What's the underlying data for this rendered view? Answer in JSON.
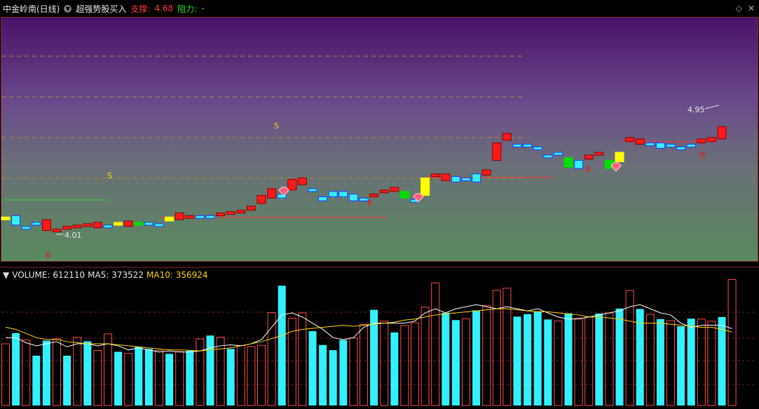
{
  "header": {
    "stock": "中金岭南(日线)",
    "indicator": "超强势股买入",
    "support_label": "支撑:",
    "support_value": "4.68",
    "resistance_label": "阻力:",
    "resistance_value": "-"
  },
  "volume_header": {
    "label": "VOLUME: 612110",
    "ma5": "MA5: 373522",
    "ma10": "MA10: 356924"
  },
  "colors": {
    "up": "#ff1a1a",
    "down": "#33f0ff",
    "flat": "#ffff00",
    "green": "#00e000"
  },
  "chart_data": {
    "type": "candlestick",
    "price_annotations": {
      "high": "4.95",
      "low": "4.01"
    },
    "markers": {
      "B": "B",
      "S": "S"
    },
    "candles": [
      {
        "o": 4.15,
        "c": 4.16,
        "h": 4.16,
        "l": 4.14,
        "t": "flat"
      },
      {
        "o": 4.17,
        "c": 4.1,
        "h": 4.17,
        "l": 4.1,
        "t": "down"
      },
      {
        "o": 4.09,
        "c": 4.08,
        "h": 4.09,
        "l": 4.07,
        "t": "down"
      },
      {
        "o": 4.11,
        "c": 4.12,
        "h": 4.13,
        "l": 4.1,
        "t": "down"
      },
      {
        "o": 4.06,
        "c": 4.14,
        "h": 4.14,
        "l": 4.05,
        "t": "up"
      },
      {
        "o": 4.06,
        "c": 4.07,
        "h": 4.08,
        "l": 4.05,
        "t": "up"
      },
      {
        "o": 4.07,
        "c": 4.09,
        "h": 4.1,
        "l": 4.06,
        "t": "up"
      },
      {
        "o": 4.08,
        "c": 4.1,
        "h": 4.1,
        "l": 4.08,
        "t": "up"
      },
      {
        "o": 4.1,
        "c": 4.11,
        "h": 4.11,
        "l": 4.09,
        "t": "up"
      },
      {
        "o": 4.08,
        "c": 4.12,
        "h": 4.12,
        "l": 4.07,
        "t": "up"
      },
      {
        "o": 4.1,
        "c": 4.08,
        "h": 4.1,
        "l": 4.08,
        "t": "down"
      },
      {
        "o": 4.1,
        "c": 4.12,
        "h": 4.12,
        "l": 4.1,
        "t": "flat"
      },
      {
        "o": 4.09,
        "c": 4.13,
        "h": 4.13,
        "l": 4.09,
        "t": "up"
      },
      {
        "o": 4.11,
        "c": 4.12,
        "h": 4.12,
        "l": 4.11,
        "t": "green"
      },
      {
        "o": 4.12,
        "c": 4.11,
        "h": 4.12,
        "l": 4.11,
        "t": "down"
      },
      {
        "o": 4.11,
        "c": 4.1,
        "h": 4.11,
        "l": 4.1,
        "t": "down"
      },
      {
        "o": 4.13,
        "c": 4.16,
        "h": 4.16,
        "l": 4.13,
        "t": "flat"
      },
      {
        "o": 4.14,
        "c": 4.19,
        "h": 4.19,
        "l": 4.14,
        "t": "up"
      },
      {
        "o": 4.16,
        "c": 4.17,
        "h": 4.17,
        "l": 4.15,
        "t": "up"
      },
      {
        "o": 4.17,
        "c": 4.16,
        "h": 4.17,
        "l": 4.16,
        "t": "down"
      },
      {
        "o": 4.17,
        "c": 4.16,
        "h": 4.17,
        "l": 4.16,
        "t": "down"
      },
      {
        "o": 4.18,
        "c": 4.19,
        "h": 4.19,
        "l": 4.17,
        "t": "up"
      },
      {
        "o": 4.18,
        "c": 4.2,
        "h": 4.2,
        "l": 4.18,
        "t": "up"
      },
      {
        "o": 4.19,
        "c": 4.21,
        "h": 4.21,
        "l": 4.19,
        "t": "up"
      },
      {
        "o": 4.21,
        "c": 4.24,
        "h": 4.24,
        "l": 4.21,
        "t": "up"
      },
      {
        "o": 4.26,
        "c": 4.32,
        "h": 4.33,
        "l": 4.26,
        "t": "up"
      },
      {
        "o": 4.3,
        "c": 4.37,
        "h": 4.38,
        "l": 4.3,
        "t": "up"
      },
      {
        "o": 4.33,
        "c": 4.3,
        "h": 4.33,
        "l": 4.29,
        "t": "down"
      },
      {
        "o": 4.36,
        "c": 4.44,
        "h": 4.44,
        "l": 4.36,
        "t": "up"
      },
      {
        "o": 4.4,
        "c": 4.45,
        "h": 4.46,
        "l": 4.39,
        "t": "up"
      },
      {
        "o": 4.37,
        "c": 4.36,
        "h": 4.37,
        "l": 4.36,
        "t": "down"
      },
      {
        "o": 4.31,
        "c": 4.28,
        "h": 4.31,
        "l": 4.28,
        "t": "down"
      },
      {
        "o": 4.35,
        "c": 4.31,
        "h": 4.35,
        "l": 4.3,
        "t": "down"
      },
      {
        "o": 4.35,
        "c": 4.31,
        "h": 4.35,
        "l": 4.3,
        "t": "down"
      },
      {
        "o": 4.33,
        "c": 4.28,
        "h": 4.33,
        "l": 4.28,
        "t": "down"
      },
      {
        "o": 4.3,
        "c": 4.3,
        "h": 4.3,
        "l": 4.3,
        "t": "down"
      },
      {
        "o": 4.31,
        "c": 4.33,
        "h": 4.33,
        "l": 4.31,
        "t": "up"
      },
      {
        "o": 4.35,
        "c": 4.36,
        "h": 4.36,
        "l": 4.34,
        "t": "up"
      },
      {
        "o": 4.35,
        "c": 4.38,
        "h": 4.38,
        "l": 4.34,
        "t": "up"
      },
      {
        "o": 4.35,
        "c": 4.3,
        "h": 4.35,
        "l": 4.29,
        "t": "green"
      },
      {
        "o": 4.29,
        "c": 4.28,
        "h": 4.29,
        "l": 4.28,
        "t": "down"
      },
      {
        "o": 4.32,
        "c": 4.45,
        "h": 4.45,
        "l": 4.32,
        "t": "flat"
      },
      {
        "o": 4.47,
        "c": 4.48,
        "h": 4.48,
        "l": 4.47,
        "t": "up"
      },
      {
        "o": 4.43,
        "c": 4.48,
        "h": 4.48,
        "l": 4.42,
        "t": "up"
      },
      {
        "o": 4.46,
        "c": 4.42,
        "h": 4.46,
        "l": 4.42,
        "t": "down"
      },
      {
        "o": 4.45,
        "c": 4.45,
        "h": 4.45,
        "l": 4.44,
        "t": "down"
      },
      {
        "o": 4.48,
        "c": 4.42,
        "h": 4.48,
        "l": 4.42,
        "t": "down"
      },
      {
        "o": 4.47,
        "c": 4.51,
        "h": 4.51,
        "l": 4.47,
        "t": "up"
      },
      {
        "o": 4.58,
        "c": 4.71,
        "h": 4.72,
        "l": 4.58,
        "t": "up"
      },
      {
        "o": 4.73,
        "c": 4.78,
        "h": 4.8,
        "l": 4.72,
        "t": "up"
      },
      {
        "o": 4.7,
        "c": 4.7,
        "h": 4.7,
        "l": 4.7,
        "t": "down"
      },
      {
        "o": 4.7,
        "c": 4.69,
        "h": 4.7,
        "l": 4.69,
        "t": "down"
      },
      {
        "o": 4.68,
        "c": 4.67,
        "h": 4.68,
        "l": 4.67,
        "t": "down"
      },
      {
        "o": 4.62,
        "c": 4.62,
        "h": 4.62,
        "l": 4.62,
        "t": "down"
      },
      {
        "o": 4.64,
        "c": 4.63,
        "h": 4.64,
        "l": 4.63,
        "t": "down"
      },
      {
        "o": 4.6,
        "c": 4.53,
        "h": 4.6,
        "l": 4.53,
        "t": "green"
      },
      {
        "o": 4.58,
        "c": 4.52,
        "h": 4.58,
        "l": 4.52,
        "t": "down"
      },
      {
        "o": 4.59,
        "c": 4.62,
        "h": 4.62,
        "l": 4.58,
        "t": "up"
      },
      {
        "o": 4.63,
        "c": 4.64,
        "h": 4.64,
        "l": 4.63,
        "t": "up"
      },
      {
        "o": 4.58,
        "c": 4.52,
        "h": 4.58,
        "l": 4.52,
        "t": "green"
      },
      {
        "o": 4.57,
        "c": 4.64,
        "h": 4.64,
        "l": 4.57,
        "t": "flat"
      },
      {
        "o": 4.72,
        "c": 4.75,
        "h": 4.75,
        "l": 4.71,
        "t": "up"
      },
      {
        "o": 4.7,
        "c": 4.74,
        "h": 4.74,
        "l": 4.7,
        "t": "up"
      },
      {
        "o": 4.71,
        "c": 4.7,
        "h": 4.71,
        "l": 4.7,
        "t": "down"
      },
      {
        "o": 4.71,
        "c": 4.67,
        "h": 4.71,
        "l": 4.67,
        "t": "down"
      },
      {
        "o": 4.7,
        "c": 4.7,
        "h": 4.7,
        "l": 4.7,
        "t": "down"
      },
      {
        "o": 4.68,
        "c": 4.67,
        "h": 4.68,
        "l": 4.67,
        "t": "down"
      },
      {
        "o": 4.7,
        "c": 4.69,
        "h": 4.7,
        "l": 4.69,
        "t": "down"
      },
      {
        "o": 4.71,
        "c": 4.74,
        "h": 4.74,
        "l": 4.71,
        "t": "up"
      },
      {
        "o": 4.72,
        "c": 4.75,
        "h": 4.75,
        "l": 4.72,
        "t": "up"
      },
      {
        "o": 4.74,
        "c": 4.83,
        "h": 4.83,
        "l": 4.74,
        "t": "up"
      }
    ],
    "volume": [
      300000,
      352000,
      318000,
      242000,
      315000,
      324000,
      242000,
      331000,
      312000,
      267000,
      348000,
      261000,
      253000,
      285000,
      275000,
      268000,
      251000,
      262000,
      266000,
      324000,
      340000,
      332000,
      275000,
      292000,
      286000,
      292000,
      451000,
      582000,
      424000,
      450000,
      361000,
      294000,
      269000,
      318000,
      328000,
      394000,
      465000,
      410000,
      355000,
      389000,
      402000,
      478000,
      596000,
      450000,
      415000,
      421000,
      462000,
      485000,
      560000,
      570000,
      432000,
      444000,
      458000,
      418000,
      411000,
      448000,
      425000,
      432000,
      447000,
      449000,
      471000,
      559000,
      469000,
      443000,
      420000,
      412000,
      385000,
      422000,
      420000,
      410000,
      430000,
      612110
    ],
    "ma5": [
      330000,
      330000,
      305000,
      290000,
      300000,
      310000,
      285000,
      300000,
      300000,
      290000,
      300000,
      290000,
      270000,
      280000,
      270000,
      260000,
      265000,
      260000,
      260000,
      265000,
      280000,
      290000,
      295000,
      290000,
      300000,
      320000,
      380000,
      440000,
      450000,
      430000,
      400000,
      370000,
      330000,
      320000,
      330000,
      380000,
      400000,
      400000,
      400000,
      400000,
      410000,
      450000,
      470000,
      450000,
      470000,
      480000,
      490000,
      480000,
      470000,
      480000,
      470000,
      460000,
      470000,
      450000,
      430000,
      420000,
      420000,
      430000,
      440000,
      450000,
      460000,
      480000,
      490000,
      470000,
      450000,
      440000,
      400000,
      380000,
      390000,
      390000,
      390000,
      373522
    ],
    "ma10": [
      380000,
      370000,
      350000,
      330000,
      320000,
      320000,
      310000,
      305000,
      300000,
      300000,
      300000,
      295000,
      290000,
      285000,
      280000,
      275000,
      270000,
      270000,
      268000,
      265000,
      270000,
      275000,
      280000,
      290000,
      300000,
      310000,
      325000,
      340000,
      360000,
      370000,
      375000,
      380000,
      385000,
      390000,
      385000,
      390000,
      395000,
      400000,
      405000,
      415000,
      420000,
      430000,
      440000,
      445000,
      450000,
      455000,
      460000,
      465000,
      470000,
      470000,
      465000,
      460000,
      455000,
      455000,
      450000,
      445000,
      440000,
      430000,
      430000,
      425000,
      420000,
      410000,
      400000,
      400000,
      400000,
      395000,
      390000,
      385000,
      380000,
      380000,
      370000,
      356924
    ],
    "vol_type": [
      "up",
      "down",
      "up",
      "down",
      "down",
      "up",
      "down",
      "up",
      "down",
      "up",
      "up",
      "down",
      "up",
      "down",
      "down",
      "up",
      "down",
      "up",
      "down",
      "up",
      "down",
      "up",
      "down",
      "up",
      "up",
      "up",
      "up",
      "down",
      "up",
      "up",
      "down",
      "down",
      "down",
      "down",
      "up",
      "up",
      "down",
      "up",
      "down",
      "up",
      "up",
      "up",
      "up",
      "down",
      "down",
      "up",
      "down",
      "up",
      "up",
      "up",
      "down",
      "down",
      "down",
      "down",
      "up",
      "down",
      "up",
      "up",
      "down",
      "up",
      "down",
      "up",
      "down",
      "up",
      "down",
      "up",
      "down",
      "down",
      "up",
      "up",
      "down",
      "up"
    ]
  }
}
